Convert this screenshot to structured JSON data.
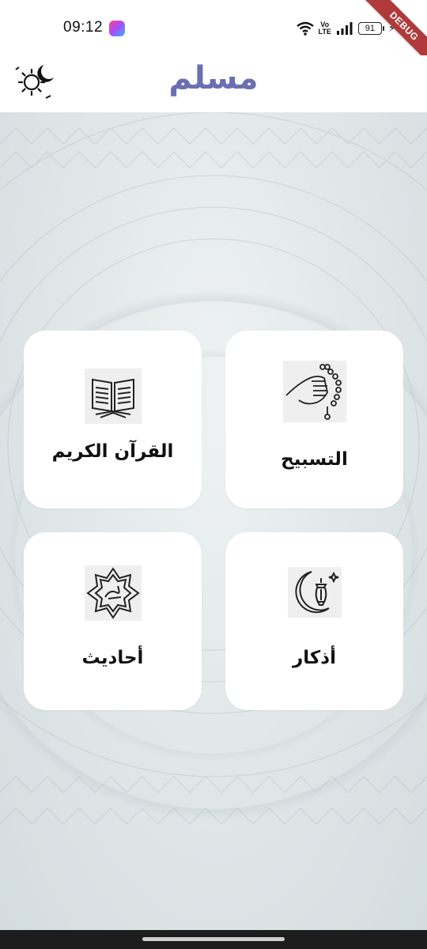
{
  "status_bar": {
    "time": "09:12",
    "network_label_top": "Vo",
    "network_label_bottom": "LTE",
    "battery_level": "91"
  },
  "debug_banner": {
    "label": "DEBUG",
    "color": "#b03a3a"
  },
  "app_bar": {
    "title": "مسلم",
    "title_color": "#6a6fb1",
    "theme_toggle_icon": "sun-moon-icon"
  },
  "menu": {
    "items": [
      {
        "label": "القرآن الكريم",
        "icon": "quran-book-icon"
      },
      {
        "label": "التسبيح",
        "icon": "tasbih-hand-icon"
      },
      {
        "label": "أحاديث",
        "icon": "muhammad-star-icon"
      },
      {
        "label": "أذكار",
        "icon": "crescent-lantern-icon"
      }
    ]
  }
}
